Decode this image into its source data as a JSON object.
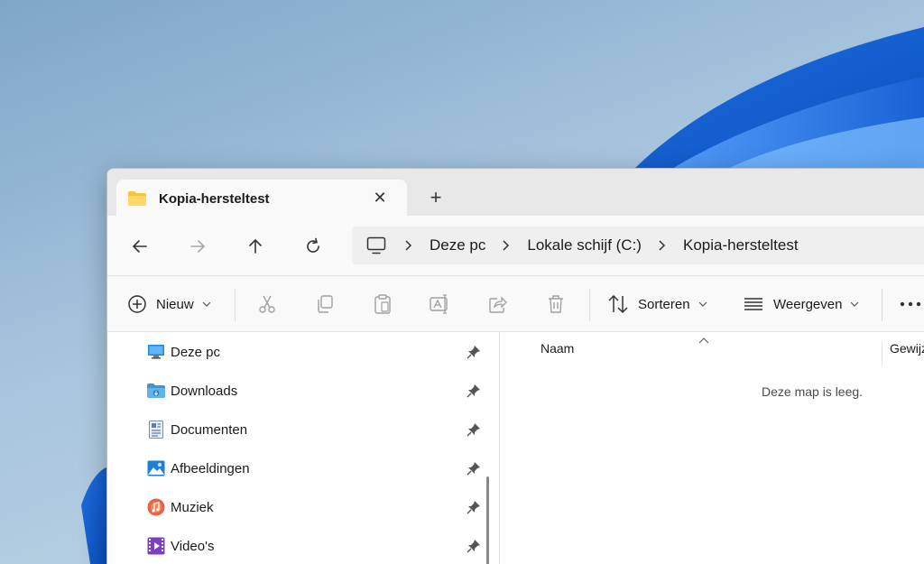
{
  "window": {
    "tab_title": "Kopia-hersteltest"
  },
  "breadcrumb": [
    "Deze pc",
    "Lokale schijf (C:)",
    "Kopia-hersteltest"
  ],
  "commandbar": {
    "new_label": "Nieuw",
    "sort_label": "Sorteren",
    "view_label": "Weergeven"
  },
  "sidebar": {
    "items": [
      {
        "label": "Deze pc",
        "icon": "monitor-icon"
      },
      {
        "label": "Downloads",
        "icon": "downloads-folder-icon"
      },
      {
        "label": "Documenten",
        "icon": "documents-icon"
      },
      {
        "label": "Afbeeldingen",
        "icon": "pictures-icon"
      },
      {
        "label": "Muziek",
        "icon": "music-icon"
      },
      {
        "label": "Video's",
        "icon": "videos-icon"
      }
    ]
  },
  "content": {
    "column_name": "Naam",
    "column_modified": "Gewijz",
    "empty_message": "Deze map is leeg."
  },
  "colors": {
    "accent": "#0067c0",
    "folder": "#f5c542"
  }
}
